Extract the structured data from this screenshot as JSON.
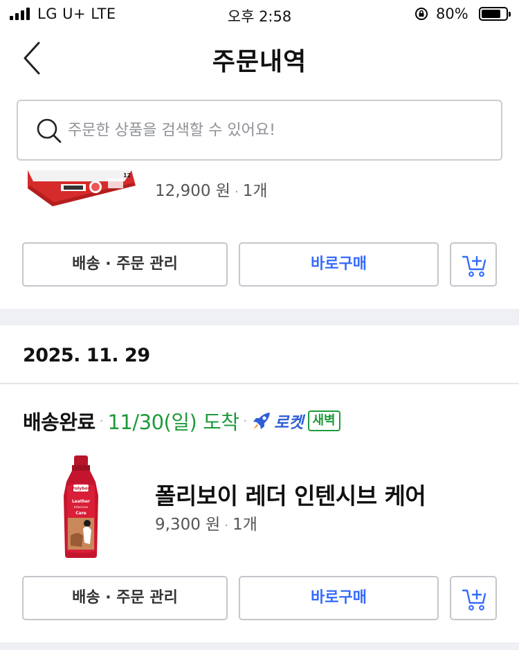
{
  "status_bar": {
    "carrier": "LG U+  LTE",
    "time": "오후 2:58",
    "battery_percent": "80%",
    "battery_level": 0.8
  },
  "nav": {
    "title": "주문내역"
  },
  "search": {
    "placeholder": "주문한 상품을 검색할 수 있어요!"
  },
  "orders": [
    {
      "price": "12,900 원",
      "quantity": "1개",
      "actions": {
        "manage": "배송 · 주문 관리",
        "buy": "바로구매"
      }
    },
    {
      "date": "2025. 11. 29",
      "status": "배송완료",
      "arrival": "11/30(일) 도착",
      "rocket_label": "로켓",
      "rocket_badge": "새벽",
      "product_title": "폴리보이 레더 인텐시브 케어",
      "price": "9,300 원",
      "quantity": "1개",
      "actions": {
        "manage": "배송 · 주문 관리",
        "buy": "바로구매"
      }
    }
  ],
  "colors": {
    "accent_blue": "#346aff",
    "delivered_green": "#1f9a3a",
    "divider": "#eef0f3"
  }
}
